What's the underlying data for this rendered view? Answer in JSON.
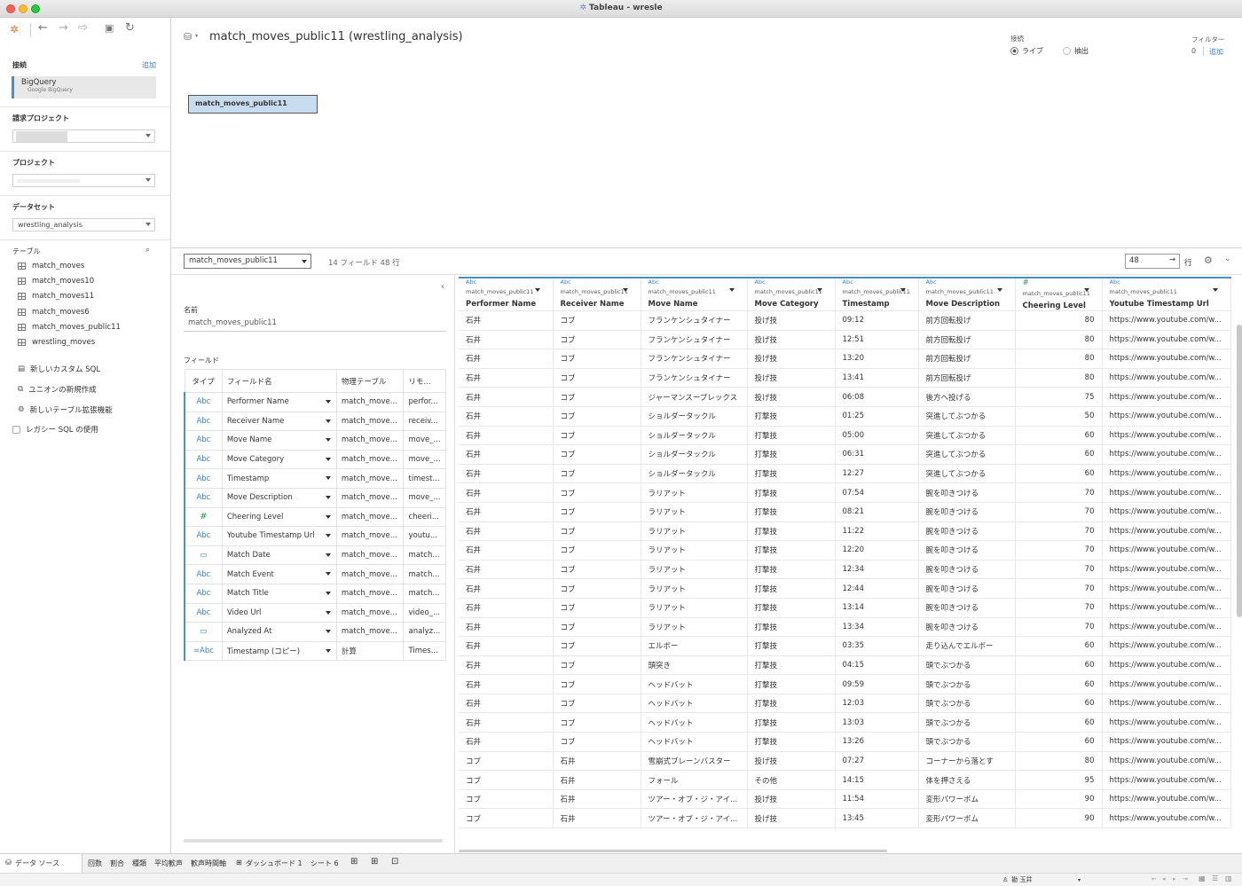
{
  "window": {
    "title": "Tableau - wresle"
  },
  "sidebar": {
    "connections_label": "接続",
    "add_label": "追加",
    "connection": {
      "name": "BigQuery",
      "sub": "Google BigQuery"
    },
    "billing_project_label": "請求プロジェクト",
    "project_label": "プロジェクト",
    "dataset_label": "データセット",
    "dataset_value": "wrestling_analysis",
    "tables_label": "テーブル",
    "tables": [
      "match_moves",
      "match_moves10",
      "match_moves11",
      "match_moves6",
      "match_moves_public11",
      "wrestling_moves"
    ],
    "actions": [
      "新しいカスタム SQL",
      "ユニオンの新規作成",
      "新しいテーブル拡張機能"
    ],
    "legacy_sql": "レガシー SQL の使用"
  },
  "canvas": {
    "datasource_title": "match_moves_public11 (wrestling_analysis)",
    "table_box": "match_moves_public11",
    "connection_label": "接続",
    "live_label": "ライブ",
    "extract_label": "抽出",
    "filter_label": "フィルター",
    "filter_count": "0",
    "filter_add": "追加"
  },
  "toolbar": {
    "table_select": "match_moves_public11",
    "info": "14 フィールド 48 行",
    "rows_value": "48",
    "rows_label": "行"
  },
  "meta": {
    "name_label": "名前",
    "name_value": "match_moves_public11",
    "fields_label": "フィールド",
    "headers": [
      "タイプ",
      "フィールド名",
      "物理テーブル",
      "リモ..."
    ],
    "fields": [
      {
        "type": "Abc",
        "name": "Performer Name",
        "table": "match_move...",
        "remote": "perfor..."
      },
      {
        "type": "Abc",
        "name": "Receiver Name",
        "table": "match_move...",
        "remote": "receiv..."
      },
      {
        "type": "Abc",
        "name": "Move Name",
        "table": "match_move...",
        "remote": "move_..."
      },
      {
        "type": "Abc",
        "name": "Move Category",
        "table": "match_move...",
        "remote": "move_..."
      },
      {
        "type": "Abc",
        "name": "Timestamp",
        "table": "match_move...",
        "remote": "timest..."
      },
      {
        "type": "Abc",
        "name": "Move Description",
        "table": "match_move...",
        "remote": "move_..."
      },
      {
        "type": "#",
        "name": "Cheering Level",
        "table": "match_move...",
        "remote": "cheeri..."
      },
      {
        "type": "Abc",
        "name": "Youtube Timestamp Url",
        "table": "match_move...",
        "remote": "youtu..."
      },
      {
        "type": "▭",
        "name": "Match Date",
        "table": "match_move...",
        "remote": "match..."
      },
      {
        "type": "Abc",
        "name": "Match Event",
        "table": "match_move...",
        "remote": "match..."
      },
      {
        "type": "Abc",
        "name": "Match Title",
        "table": "match_move...",
        "remote": "match..."
      },
      {
        "type": "Abc",
        "name": "Video Url",
        "table": "match_move...",
        "remote": "video_..."
      },
      {
        "type": "▭",
        "name": "Analyzed At",
        "table": "match_move...",
        "remote": "analyz..."
      },
      {
        "type": "=Abc",
        "name": "Timestamp (コピー)",
        "table": "計算",
        "remote": "Times..."
      }
    ]
  },
  "grid": {
    "columns": [
      {
        "type": "Abc",
        "src": "match_moves_public11",
        "name": "Performer Name"
      },
      {
        "type": "Abc",
        "src": "match_moves_public11",
        "name": "Receiver Name"
      },
      {
        "type": "Abc",
        "src": "match_moves_public11",
        "name": "Move Name"
      },
      {
        "type": "Abc",
        "src": "match_moves_public11",
        "name": "Move Category"
      },
      {
        "type": "Abc",
        "src": "match_moves_public11",
        "name": "Timestamp"
      },
      {
        "type": "Abc",
        "src": "match_moves_public11",
        "name": "Move Description"
      },
      {
        "type": "#",
        "src": "match_moves_public11",
        "name": "Cheering Level"
      },
      {
        "type": "Abc",
        "src": "match_moves_public11",
        "name": "Youtube Timestamp Url"
      }
    ],
    "rows": [
      [
        "石井",
        "コブ",
        "フランケンシュタイナー",
        "投げ技",
        "09:12",
        "前方回転投げ",
        "80",
        "https://www.youtube.com/w..."
      ],
      [
        "石井",
        "コブ",
        "フランケンシュタイナー",
        "投げ技",
        "12:51",
        "前方回転投げ",
        "80",
        "https://www.youtube.com/w..."
      ],
      [
        "石井",
        "コブ",
        "フランケンシュタイナー",
        "投げ技",
        "13:20",
        "前方回転投げ",
        "80",
        "https://www.youtube.com/w..."
      ],
      [
        "石井",
        "コブ",
        "フランケンシュタイナー",
        "投げ技",
        "13:41",
        "前方回転投げ",
        "80",
        "https://www.youtube.com/w..."
      ],
      [
        "石井",
        "コブ",
        "ジャーマンスープレックス",
        "投げ技",
        "06:08",
        "後方へ投げる",
        "75",
        "https://www.youtube.com/w..."
      ],
      [
        "石井",
        "コブ",
        "ショルダータックル",
        "打撃技",
        "01:25",
        "突進してぶつかる",
        "50",
        "https://www.youtube.com/w..."
      ],
      [
        "石井",
        "コブ",
        "ショルダータックル",
        "打撃技",
        "05:00",
        "突進してぶつかる",
        "60",
        "https://www.youtube.com/w..."
      ],
      [
        "石井",
        "コブ",
        "ショルダータックル",
        "打撃技",
        "06:31",
        "突進してぶつかる",
        "60",
        "https://www.youtube.com/w..."
      ],
      [
        "石井",
        "コブ",
        "ショルダータックル",
        "打撃技",
        "12:27",
        "突進してぶつかる",
        "60",
        "https://www.youtube.com/w..."
      ],
      [
        "石井",
        "コブ",
        "ラリアット",
        "打撃技",
        "07:54",
        "腕を叩きつける",
        "70",
        "https://www.youtube.com/w..."
      ],
      [
        "石井",
        "コブ",
        "ラリアット",
        "打撃技",
        "08:21",
        "腕を叩きつける",
        "70",
        "https://www.youtube.com/w..."
      ],
      [
        "石井",
        "コブ",
        "ラリアット",
        "打撃技",
        "11:22",
        "腕を叩きつける",
        "70",
        "https://www.youtube.com/w..."
      ],
      [
        "石井",
        "コブ",
        "ラリアット",
        "打撃技",
        "12:20",
        "腕を叩きつける",
        "70",
        "https://www.youtube.com/w..."
      ],
      [
        "石井",
        "コブ",
        "ラリアット",
        "打撃技",
        "12:34",
        "腕を叩きつける",
        "70",
        "https://www.youtube.com/w..."
      ],
      [
        "石井",
        "コブ",
        "ラリアット",
        "打撃技",
        "12:44",
        "腕を叩きつける",
        "70",
        "https://www.youtube.com/w..."
      ],
      [
        "石井",
        "コブ",
        "ラリアット",
        "打撃技",
        "13:14",
        "腕を叩きつける",
        "70",
        "https://www.youtube.com/w..."
      ],
      [
        "石井",
        "コブ",
        "ラリアット",
        "打撃技",
        "13:34",
        "腕を叩きつける",
        "70",
        "https://www.youtube.com/w..."
      ],
      [
        "石井",
        "コブ",
        "エルボー",
        "打撃技",
        "03:35",
        "走り込んでエルボー",
        "60",
        "https://www.youtube.com/w..."
      ],
      [
        "石井",
        "コブ",
        "頭突き",
        "打撃技",
        "04:15",
        "頭でぶつかる",
        "60",
        "https://www.youtube.com/w..."
      ],
      [
        "石井",
        "コブ",
        "ヘッドバット",
        "打撃技",
        "09:59",
        "頭でぶつかる",
        "60",
        "https://www.youtube.com/w..."
      ],
      [
        "石井",
        "コブ",
        "ヘッドバット",
        "打撃技",
        "12:03",
        "頭でぶつかる",
        "60",
        "https://www.youtube.com/w..."
      ],
      [
        "石井",
        "コブ",
        "ヘッドバット",
        "打撃技",
        "13:03",
        "頭でぶつかる",
        "60",
        "https://www.youtube.com/w..."
      ],
      [
        "石井",
        "コブ",
        "ヘッドバット",
        "打撃技",
        "13:26",
        "頭でぶつかる",
        "60",
        "https://www.youtube.com/w..."
      ],
      [
        "コブ",
        "石井",
        "雪崩式ブレーンバスター",
        "投げ技",
        "07:27",
        "コーナーから落とす",
        "80",
        "https://www.youtube.com/w..."
      ],
      [
        "コブ",
        "石井",
        "フォール",
        "その他",
        "14:15",
        "体を押さえる",
        "95",
        "https://www.youtube.com/w..."
      ],
      [
        "コブ",
        "石井",
        "ツアー・オブ・ジ・アイ...",
        "投げ技",
        "11:54",
        "変形パワーボム",
        "90",
        "https://www.youtube.com/w..."
      ],
      [
        "コブ",
        "石井",
        "ツアー・オブ・ジ・アイ...",
        "投げ技",
        "13:45",
        "変形パワーボム",
        "90",
        "https://www.youtube.com/w..."
      ]
    ]
  },
  "bottom_tabs": [
    "データ ソース",
    "回数",
    "割合",
    "種類",
    "平均歓声",
    "歓声時間軸",
    "ダッシュボード 1",
    "シート 6"
  ],
  "status": {
    "user": "勘 玉井"
  }
}
